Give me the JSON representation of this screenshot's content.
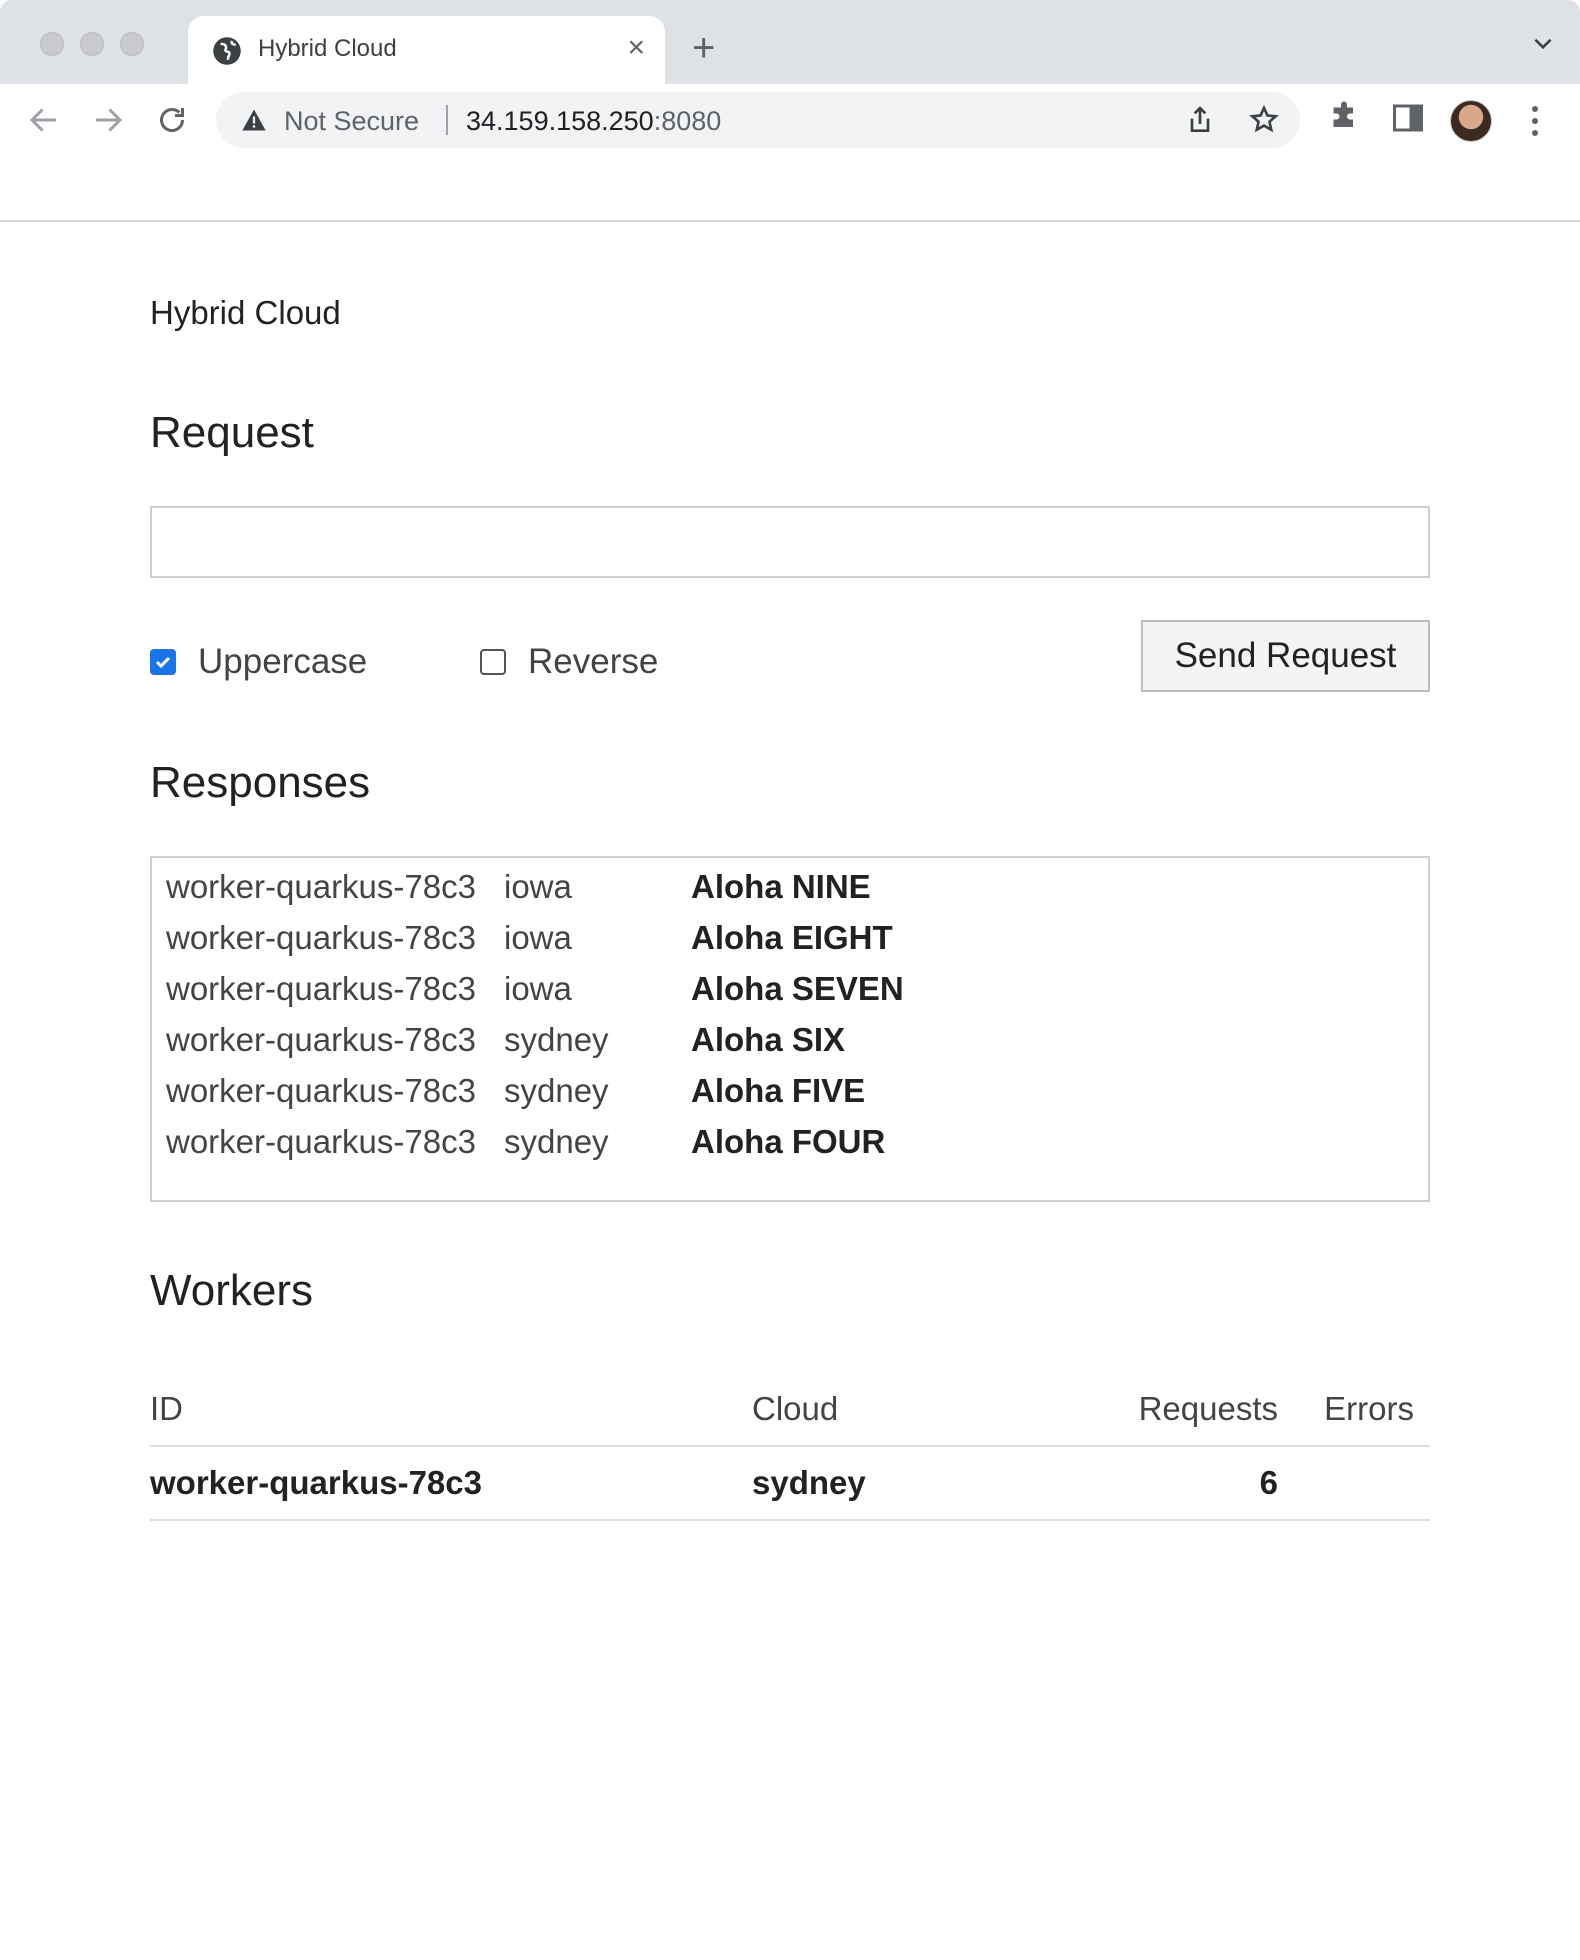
{
  "browser": {
    "tab": {
      "title": "Hybrid Cloud",
      "close_glyph": "×",
      "icon": "globe-icon"
    },
    "new_tab_glyph": "+",
    "address_bar": {
      "security_label": "Not Secure",
      "url_host": "34.159.158.250",
      "url_port": ":8080"
    }
  },
  "app": {
    "brand": "Hybrid Cloud",
    "request": {
      "heading": "Request",
      "input_value": "",
      "options": [
        {
          "label": "Uppercase",
          "checked": true
        },
        {
          "label": "Reverse",
          "checked": false
        }
      ],
      "send_label": "Send Request"
    },
    "responses": {
      "heading": "Responses",
      "rows": [
        {
          "worker": "worker-quarkus-78c3",
          "cloud": "iowa",
          "text": "Aloha NINE"
        },
        {
          "worker": "worker-quarkus-78c3",
          "cloud": "iowa",
          "text": "Aloha EIGHT"
        },
        {
          "worker": "worker-quarkus-78c3",
          "cloud": "iowa",
          "text": "Aloha SEVEN"
        },
        {
          "worker": "worker-quarkus-78c3",
          "cloud": "sydney",
          "text": "Aloha SIX"
        },
        {
          "worker": "worker-quarkus-78c3",
          "cloud": "sydney",
          "text": "Aloha FIVE"
        },
        {
          "worker": "worker-quarkus-78c3",
          "cloud": "sydney",
          "text": "Aloha FOUR"
        }
      ]
    },
    "workers": {
      "heading": "Workers",
      "columns": {
        "id": "ID",
        "cloud": "Cloud",
        "requests": "Requests",
        "errors": "Errors"
      },
      "rows": [
        {
          "id": "worker-quarkus-78c3",
          "cloud": "sydney",
          "requests": "6",
          "errors": ""
        }
      ]
    }
  },
  "colors": {
    "checkbox_accent": "#1a73e8",
    "tabstrip": "#dee1e6",
    "omnibox": "#f1f3f4"
  }
}
